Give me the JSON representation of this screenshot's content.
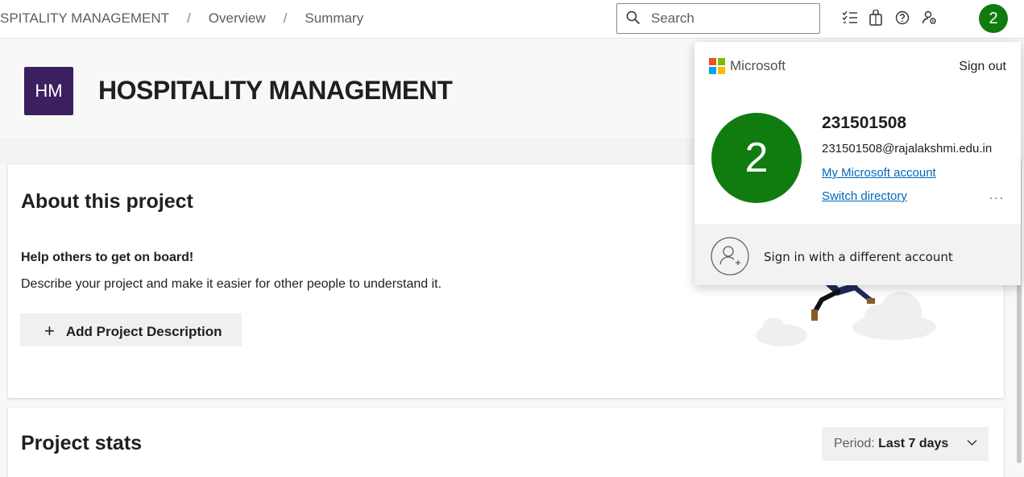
{
  "topbar": {
    "breadcrumb": [
      "SPITALITY MANAGEMENT",
      "Overview",
      "Summary"
    ],
    "breadcrumb_separator": "/",
    "search_placeholder": "Search",
    "icons": [
      "task-list-icon",
      "shopping-bag-icon",
      "help-icon",
      "user-settings-icon"
    ],
    "avatar_initial": "2"
  },
  "project": {
    "logo_initials": "HM",
    "logo_color": "#3b1f5e",
    "title": "HOSPITALITY MANAGEMENT"
  },
  "about": {
    "title": "About this project",
    "help_title": "Help others to get on board!",
    "help_desc": "Describe your project and make it easier for other people to understand it.",
    "add_button_icon": "+",
    "add_button_label": "Add Project Description"
  },
  "stats": {
    "title": "Project stats",
    "period_label": "Period:",
    "period_value": "Last 7 days"
  },
  "account_panel": {
    "brand": "Microsoft",
    "sign_out": "Sign out",
    "avatar_initial": "2",
    "avatar_color": "#107c10",
    "user_id": "231501508",
    "email": "231501508@rajalakshmi.edu.in",
    "my_account_link": "My Microsoft account",
    "switch_directory_link": "Switch directory",
    "more_label": "...",
    "different_account": "Sign in with a different account"
  },
  "colors": {
    "accent_link": "#0067b8",
    "avatar_green": "#107c10"
  }
}
